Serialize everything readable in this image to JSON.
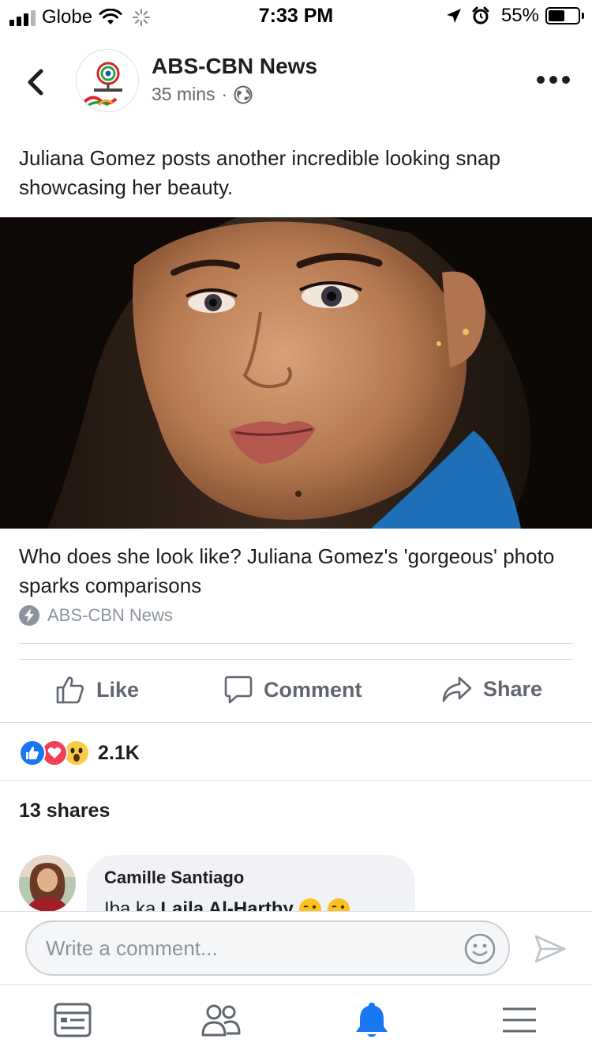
{
  "status_bar": {
    "carrier": "Globe",
    "time": "7:33 PM",
    "battery_percent": "55%",
    "battery_level": 0.55
  },
  "post": {
    "page_name": "ABS-CBN News",
    "time_ago": "35 mins",
    "separator": "·",
    "text": "Juliana Gomez posts another incredible looking snap showcasing her beauty.",
    "link_title": "Who does she look like? Juliana Gomez's 'gorgeous' photo sparks comparisons",
    "link_source": "ABS-CBN News",
    "avatar_logo_text": "ABS-CBN"
  },
  "actions": {
    "like": "Like",
    "comment": "Comment",
    "share": "Share"
  },
  "reactions": {
    "count": "2.1K",
    "types": [
      "like",
      "love",
      "wow"
    ]
  },
  "shares": "13 shares",
  "comment": {
    "author": "Camille Santiago",
    "text_prefix": "Iba ka",
    "mention": "Laila Al-Harthy"
  },
  "composer": {
    "placeholder": "Write a comment..."
  },
  "colors": {
    "facebook_blue": "#1877f2",
    "love_red": "#f33e58",
    "wow_yellow": "#fccb45",
    "secondary_text": "#606770"
  }
}
